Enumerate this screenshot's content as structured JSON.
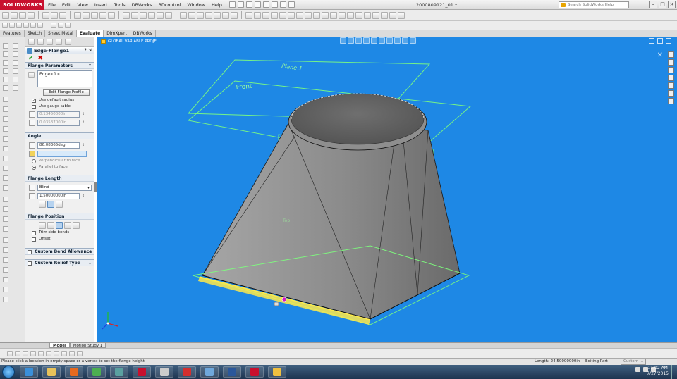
{
  "app": {
    "logo_text": "SOLIDWORKS",
    "menu": [
      "File",
      "Edit",
      "View",
      "Insert",
      "Tools",
      "DBWorks",
      "3Dcontrol",
      "Window",
      "Help"
    ],
    "document_title": "2000809121_01 *",
    "search_placeholder": "Search SolidWorks Help"
  },
  "command_tabs": [
    {
      "label": "Features",
      "active": false
    },
    {
      "label": "Sketch",
      "active": false
    },
    {
      "label": "Sheet Metal",
      "active": false
    },
    {
      "label": "Evaluate",
      "active": true
    },
    {
      "label": "DimXpert",
      "active": false
    },
    {
      "label": "DBWorks",
      "active": false
    }
  ],
  "property_manager": {
    "title": "Edge-Flange1",
    "title_controls": "? ⇲",
    "flange_parameters": {
      "header": "Flange Parameters",
      "edge_item": "Edge<1>",
      "edit_profile_button": "Edit Flange Profile",
      "use_default_radius": "Use default radius",
      "use_gauge_table": "Use gauge table",
      "radius_value": "0.13450000in",
      "thickness_value": "0.03537000in"
    },
    "angle": {
      "header": "Angle",
      "angle_value": "86.08365deg",
      "perpendicular": "Perpendicular to face",
      "parallel": "Parallel to face"
    },
    "flange_length": {
      "header": "Flange Length",
      "end_condition": "Blind",
      "length_value": "1.50000000in"
    },
    "flange_position": {
      "header": "Flange Position",
      "trim_side_bends": "Trim side bends",
      "offset": "Offset"
    },
    "custom_bend_allowance": "Custom Bend Allowance",
    "custom_relief_type": "Custom Relief Type"
  },
  "viewport": {
    "tree_root": "GLOBAL VARIABLE PROJE...",
    "plane_labels": [
      "Plane 1",
      "Front",
      "Right",
      "Top"
    ],
    "background_color": "#1e88e5",
    "part_color": "#8a8a8a",
    "plane_color": "#7dff7d",
    "edge_highlight_color": "#ffe94a"
  },
  "bottom_tabs": [
    {
      "label": "Model",
      "active": true
    },
    {
      "label": "Motion Study 1",
      "active": false
    }
  ],
  "status": {
    "message": "Please click a location in empty space or a vertex to set the flange height",
    "length": "Length: 24.50000000in",
    "mode": "Editing Part",
    "customize": "Custom ..."
  },
  "taskbar": {
    "time": "11:02 AM",
    "date": "7/27/2015",
    "apps": [
      {
        "icon": "internet-explorer-icon",
        "color": "#3a8fd9"
      },
      {
        "icon": "file-explorer-icon",
        "color": "#e8c25a"
      },
      {
        "icon": "firefox-icon",
        "color": "#e66a1f"
      },
      {
        "icon": "chrome-icon",
        "color": "#4caf50"
      },
      {
        "icon": "mathcad-icon",
        "color": "#5aa0a0"
      },
      {
        "icon": "solidworks-icon",
        "color": "#c8102e"
      },
      {
        "icon": "scissors-icon",
        "color": "#cccccc"
      },
      {
        "icon": "acrobat-icon",
        "color": "#d32f2f"
      },
      {
        "icon": "remote-desktop-icon",
        "color": "#6fa8dc"
      },
      {
        "icon": "word-icon",
        "color": "#2b579a"
      },
      {
        "icon": "solidworks-icon",
        "color": "#c8102e"
      },
      {
        "icon": "folder-icon",
        "color": "#f0c040"
      }
    ]
  }
}
